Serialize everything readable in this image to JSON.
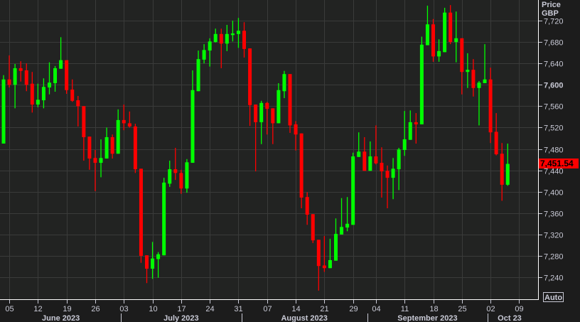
{
  "chart_data": {
    "type": "candlestick",
    "title": "",
    "ylabel": "Price",
    "currency": "GBP",
    "ylim": [
      7200,
      7759
    ],
    "grid": true,
    "up_color": "#00ff00",
    "down_color": "#ff0000",
    "last_price": "7,451.54",
    "last_price_value": 7451.54,
    "y_ticks": [
      {
        "value": 7720,
        "label": "7,720"
      },
      {
        "value": 7680,
        "label": "7,680"
      },
      {
        "value": 7640,
        "label": "7,640"
      },
      {
        "value": 7600,
        "label": "7,600",
        "bold": true
      },
      {
        "value": 7560,
        "label": "7,560"
      },
      {
        "value": 7520,
        "label": "7,520"
      },
      {
        "value": 7480,
        "label": "7,480"
      },
      {
        "value": 7440,
        "label": "7,440"
      },
      {
        "value": 7400,
        "label": "7,400"
      },
      {
        "value": 7360,
        "label": "7,360"
      },
      {
        "value": 7320,
        "label": "7,320"
      },
      {
        "value": 7280,
        "label": "7,280"
      },
      {
        "value": 7240,
        "label": "7,240"
      }
    ],
    "x_ticks": [
      {
        "index": 1,
        "label": "05"
      },
      {
        "index": 6,
        "label": "12"
      },
      {
        "index": 11,
        "label": "19"
      },
      {
        "index": 16,
        "label": "26"
      },
      {
        "index": 21,
        "label": "03"
      },
      {
        "index": 26,
        "label": "10"
      },
      {
        "index": 31,
        "label": "17"
      },
      {
        "index": 36,
        "label": "24"
      },
      {
        "index": 41,
        "label": "31"
      },
      {
        "index": 46,
        "label": "07"
      },
      {
        "index": 51,
        "label": "14"
      },
      {
        "index": 56,
        "label": "21"
      },
      {
        "index": 61,
        "label": "29"
      },
      {
        "index": 65,
        "label": "04"
      },
      {
        "index": 70,
        "label": "11"
      },
      {
        "index": 75,
        "label": "18"
      },
      {
        "index": 80,
        "label": "25"
      },
      {
        "index": 85,
        "label": "02"
      },
      {
        "index": 90,
        "label": "09"
      }
    ],
    "months": [
      {
        "label": "June 2023",
        "start": 0,
        "end": 21
      },
      {
        "label": "July 2023",
        "start": 21,
        "end": 42
      },
      {
        "label": "August 2023",
        "start": 42,
        "end": 64
      },
      {
        "label": "September 2023",
        "start": 64,
        "end": 85
      },
      {
        "label": "Oct 23",
        "start": 85,
        "end": 89
      }
    ],
    "ohlc_fields": [
      "open",
      "high",
      "low",
      "close"
    ],
    "candles": [
      [
        7490,
        7618,
        7490,
        7610
      ],
      [
        7610,
        7655,
        7595,
        7600
      ],
      [
        7600,
        7639,
        7556,
        7631
      ],
      [
        7631,
        7644,
        7606,
        7626
      ],
      [
        7627,
        7640,
        7588,
        7600
      ],
      [
        7602,
        7624,
        7548,
        7563
      ],
      [
        7563,
        7602,
        7558,
        7572
      ],
      [
        7571,
        7612,
        7556,
        7596
      ],
      [
        7595,
        7642,
        7582,
        7604
      ],
      [
        7603,
        7635,
        7587,
        7631
      ],
      [
        7630,
        7689,
        7630,
        7646
      ],
      [
        7646,
        7646,
        7583,
        7590
      ],
      [
        7591,
        7610,
        7568,
        7570
      ],
      [
        7571,
        7579,
        7522,
        7560
      ],
      [
        7560,
        7560,
        7458,
        7502
      ],
      [
        7503,
        7503,
        7441,
        7462
      ],
      [
        7463,
        7478,
        7401,
        7454
      ],
      [
        7454,
        7498,
        7427,
        7463
      ],
      [
        7462,
        7520,
        7462,
        7502
      ],
      [
        7502,
        7507,
        7462,
        7471
      ],
      [
        7471,
        7554,
        7471,
        7534
      ],
      [
        7534,
        7563,
        7515,
        7528
      ],
      [
        7528,
        7550,
        7520,
        7522
      ],
      [
        7522,
        7527,
        7435,
        7442
      ],
      [
        7443,
        7443,
        7267,
        7280
      ],
      [
        7281,
        7281,
        7229,
        7256
      ],
      [
        7256,
        7306,
        7237,
        7275
      ],
      [
        7274,
        7287,
        7239,
        7283
      ],
      [
        7281,
        7426,
        7281,
        7417
      ],
      [
        7415,
        7458,
        7409,
        7442
      ],
      [
        7442,
        7482,
        7422,
        7435
      ],
      [
        7435,
        7441,
        7396,
        7406
      ],
      [
        7406,
        7461,
        7398,
        7455
      ],
      [
        7454,
        7627,
        7454,
        7590
      ],
      [
        7588,
        7664,
        7588,
        7648
      ],
      [
        7647,
        7676,
        7640,
        7665
      ],
      [
        7664,
        7687,
        7634,
        7681
      ],
      [
        7680,
        7705,
        7679,
        7695
      ],
      [
        7695,
        7705,
        7631,
        7677
      ],
      [
        7677,
        7712,
        7663,
        7695
      ],
      [
        7693,
        7720,
        7681,
        7696
      ],
      [
        7695,
        7725,
        7669,
        7701
      ],
      [
        7701,
        7717,
        7651,
        7667
      ],
      [
        7668,
        7668,
        7523,
        7562
      ],
      [
        7563,
        7563,
        7438,
        7530
      ],
      [
        7530,
        7570,
        7489,
        7566
      ],
      [
        7566,
        7568,
        7507,
        7555
      ],
      [
        7556,
        7556,
        7489,
        7528
      ],
      [
        7528,
        7603,
        7528,
        7590
      ],
      [
        7588,
        7626,
        7575,
        7620
      ],
      [
        7620,
        7620,
        7510,
        7524
      ],
      [
        7526,
        7532,
        7477,
        7507
      ],
      [
        7509,
        7509,
        7369,
        7389
      ],
      [
        7390,
        7399,
        7338,
        7357
      ],
      [
        7358,
        7358,
        7304,
        7309
      ],
      [
        7310,
        7310,
        7215,
        7261
      ],
      [
        7262,
        7317,
        7250,
        7257
      ],
      [
        7257,
        7312,
        7257,
        7272
      ],
      [
        7271,
        7350,
        7271,
        7321
      ],
      [
        7320,
        7388,
        7320,
        7334
      ],
      [
        7333,
        7390,
        7326,
        7340
      ],
      [
        7338,
        7473,
        7338,
        7466
      ],
      [
        7465,
        7511,
        7465,
        7475
      ],
      [
        7475,
        7502,
        7439,
        7439
      ],
      [
        7439,
        7494,
        7439,
        7466
      ],
      [
        7466,
        7524,
        7451,
        7453
      ],
      [
        7454,
        7483,
        7389,
        7438
      ],
      [
        7439,
        7449,
        7369,
        7426
      ],
      [
        7426,
        7463,
        7386,
        7443
      ],
      [
        7442,
        7482,
        7403,
        7479
      ],
      [
        7478,
        7551,
        7467,
        7498
      ],
      [
        7497,
        7552,
        7497,
        7530
      ],
      [
        7530,
        7547,
        7490,
        7526
      ],
      [
        7526,
        7690,
        7526,
        7675
      ],
      [
        7674,
        7748,
        7674,
        7713
      ],
      [
        7713,
        7723,
        7643,
        7653
      ],
      [
        7653,
        7685,
        7643,
        7663
      ],
      [
        7661,
        7744,
        7661,
        7735
      ],
      [
        7735,
        7749,
        7676,
        7680
      ],
      [
        7680,
        7737,
        7642,
        7687
      ],
      [
        7687,
        7687,
        7582,
        7624
      ],
      [
        7624,
        7659,
        7594,
        7628
      ],
      [
        7628,
        7648,
        7578,
        7594
      ],
      [
        7594,
        7607,
        7524,
        7604
      ],
      [
        7603,
        7676,
        7603,
        7610
      ],
      [
        7610,
        7632,
        7491,
        7511
      ],
      [
        7512,
        7547,
        7468,
        7470
      ],
      [
        7471,
        7491,
        7383,
        7413
      ],
      [
        7413,
        7490,
        7411,
        7452
      ]
    ]
  },
  "axis": {
    "price_label": "Price",
    "currency_label": "GBP",
    "auto_button": "Auto"
  }
}
